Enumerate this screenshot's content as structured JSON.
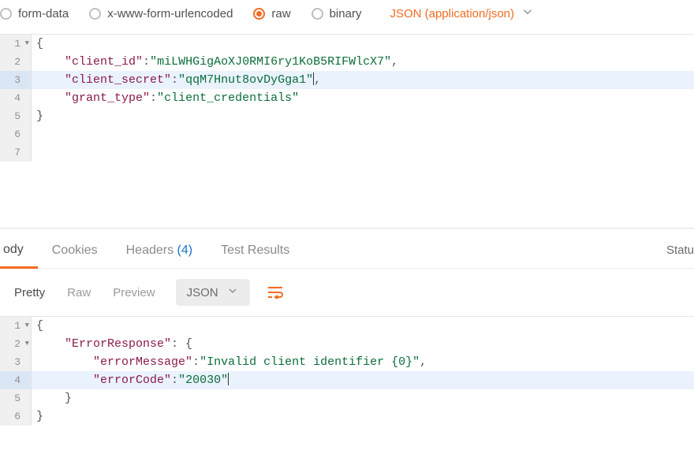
{
  "colors": {
    "accent": "#f26b21",
    "link": "#1a73c9"
  },
  "bodyTypes": {
    "options": [
      {
        "id": "form-data",
        "label": "form-data",
        "selected": false
      },
      {
        "id": "urlencoded",
        "label": "x-www-form-urlencoded",
        "selected": false
      },
      {
        "id": "raw",
        "label": "raw",
        "selected": true
      },
      {
        "id": "binary",
        "label": "binary",
        "selected": false
      }
    ],
    "contentType": "JSON (application/json)"
  },
  "requestEditor": {
    "language": "json",
    "lines": [
      {
        "n": 1,
        "fold": true,
        "text": "{"
      },
      {
        "n": 2,
        "indent": 1,
        "key": "client_id",
        "value": "miLWHGigAoXJ0RMI6ry1KoB5RIFWlcX7",
        "comma": true
      },
      {
        "n": 3,
        "indent": 1,
        "key": "client_secret",
        "value": "qqM7Hnut8ovDyGga1",
        "comma": true,
        "highlight": true,
        "cursorAfterValue": true
      },
      {
        "n": 4,
        "indent": 1,
        "key": "grant_type",
        "value": "client_credentials"
      },
      {
        "n": 5,
        "text": "}"
      },
      {
        "n": 6,
        "text": ""
      },
      {
        "n": 7,
        "text": ""
      }
    ]
  },
  "responseTabs": {
    "items": [
      {
        "id": "body",
        "label": "ody",
        "active": true
      },
      {
        "id": "cookies",
        "label": "Cookies"
      },
      {
        "id": "headers",
        "label": "Headers",
        "count": "(4)"
      },
      {
        "id": "test",
        "label": "Test Results"
      }
    ],
    "statusLabel": "Statu"
  },
  "viewBar": {
    "modes": [
      {
        "id": "pretty",
        "label": "Pretty",
        "active": true
      },
      {
        "id": "raw",
        "label": "Raw"
      },
      {
        "id": "preview",
        "label": "Preview"
      }
    ],
    "format": "JSON"
  },
  "responseEditor": {
    "language": "json",
    "lines": [
      {
        "n": 1,
        "fold": true,
        "text": "{"
      },
      {
        "n": 2,
        "fold": true,
        "indent": 1,
        "key": "ErrorResponse",
        "open": true
      },
      {
        "n": 3,
        "indent": 2,
        "key": "errorMessage",
        "value": "Invalid client identifier {0}",
        "comma": true
      },
      {
        "n": 4,
        "indent": 2,
        "key": "errorCode",
        "value": "20030",
        "highlight": true,
        "cursorAfterValue": true
      },
      {
        "n": 5,
        "indent": 1,
        "text": "}"
      },
      {
        "n": 6,
        "text": "}"
      }
    ]
  }
}
